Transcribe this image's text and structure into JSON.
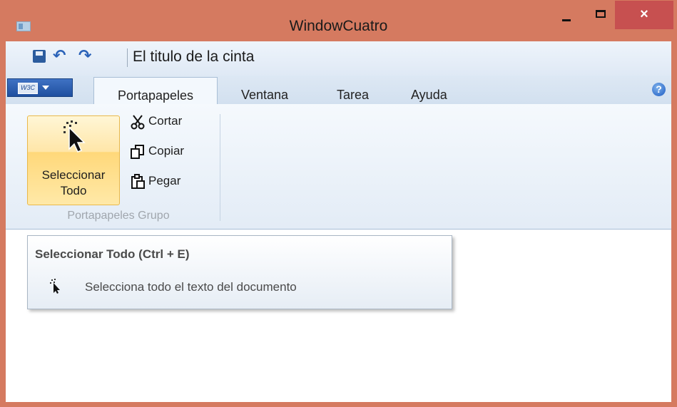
{
  "window": {
    "title": "WindowCuatro",
    "close_glyph": "×",
    "colors": {
      "frame": "#d57a60",
      "close": "#c75050",
      "ribbon_accent": "#1f4f9f",
      "highlight": "#ffd87a"
    }
  },
  "qat": {
    "title": "El titulo de la cinta",
    "undo_glyph": "↶",
    "redo_glyph": "↷",
    "icons": [
      "save-icon",
      "undo-icon",
      "redo-icon"
    ]
  },
  "app_menu": {
    "logo_text": "W3C"
  },
  "tabs": [
    {
      "label": "Portapapeles",
      "active": true
    },
    {
      "label": "Ventana",
      "active": false
    },
    {
      "label": "Tarea",
      "active": false
    },
    {
      "label": "Ayuda",
      "active": false
    }
  ],
  "help": {
    "glyph": "?"
  },
  "ribbon": {
    "select_all": {
      "line1": "Seleccionar",
      "line2": "Todo"
    },
    "cut": {
      "label": "Cortar"
    },
    "copy": {
      "label": "Copiar"
    },
    "paste": {
      "label": "Pegar"
    },
    "group_label": "Portapapeles Grupo"
  },
  "tooltip": {
    "title": "Seleccionar Todo (Ctrl + E)",
    "description": "Selecciona todo el texto del documento"
  }
}
